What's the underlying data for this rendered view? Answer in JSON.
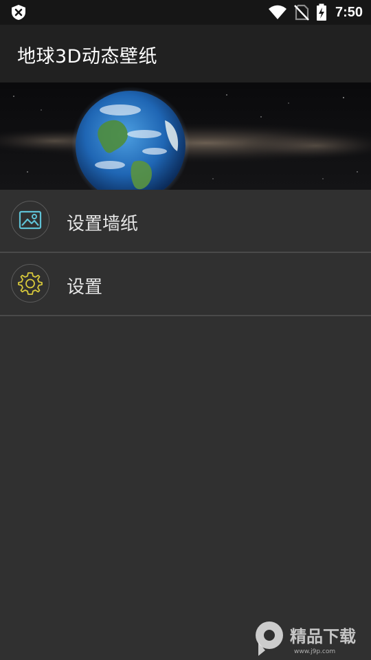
{
  "status_bar": {
    "time": "7:50",
    "icons": [
      "shield-icon",
      "wifi-icon",
      "no-sim-icon",
      "battery-charging-icon"
    ]
  },
  "app_bar": {
    "title": "地球3D动态壁纸"
  },
  "banner": {
    "image": "earth-milky-way-banner"
  },
  "menu": {
    "items": [
      {
        "label": "设置墙纸",
        "icon": "image-icon",
        "icon_color": "#5fc2d6"
      },
      {
        "label": "设置",
        "icon": "gear-icon",
        "icon_color": "#d8c93b"
      }
    ]
  },
  "watermark": {
    "brand": "精品下载",
    "url": "www.j9p.com"
  },
  "colors": {
    "background": "#303030",
    "app_bar": "#212121",
    "status_bar": "#161616",
    "divider": "#4a4a4a"
  }
}
